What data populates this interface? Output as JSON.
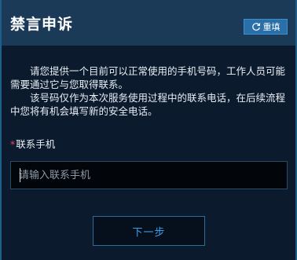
{
  "dialog": {
    "title": "禁言申诉",
    "reset_label": "重填",
    "reset_icon": "refresh-icon"
  },
  "description": {
    "paragraph1": "请您提供一个目前可以正常使用的手机号码，工作人员可能需要通过它与您取得联系。",
    "paragraph2": "该号码仅作为本次服务使用过程中的联系电话，在后续流程中您将有机会填写新的安全电话。"
  },
  "form": {
    "required_mark": "*",
    "phone_label": "联系手机",
    "phone_placeholder": "请输入联系手机",
    "phone_value": ""
  },
  "actions": {
    "next_label": "下一步"
  },
  "colors": {
    "background": "#0b1a2c",
    "header": "#1b3a57",
    "accent": "#2a6fa8",
    "next_text": "#3aa0ea",
    "required": "#e34b4b"
  }
}
